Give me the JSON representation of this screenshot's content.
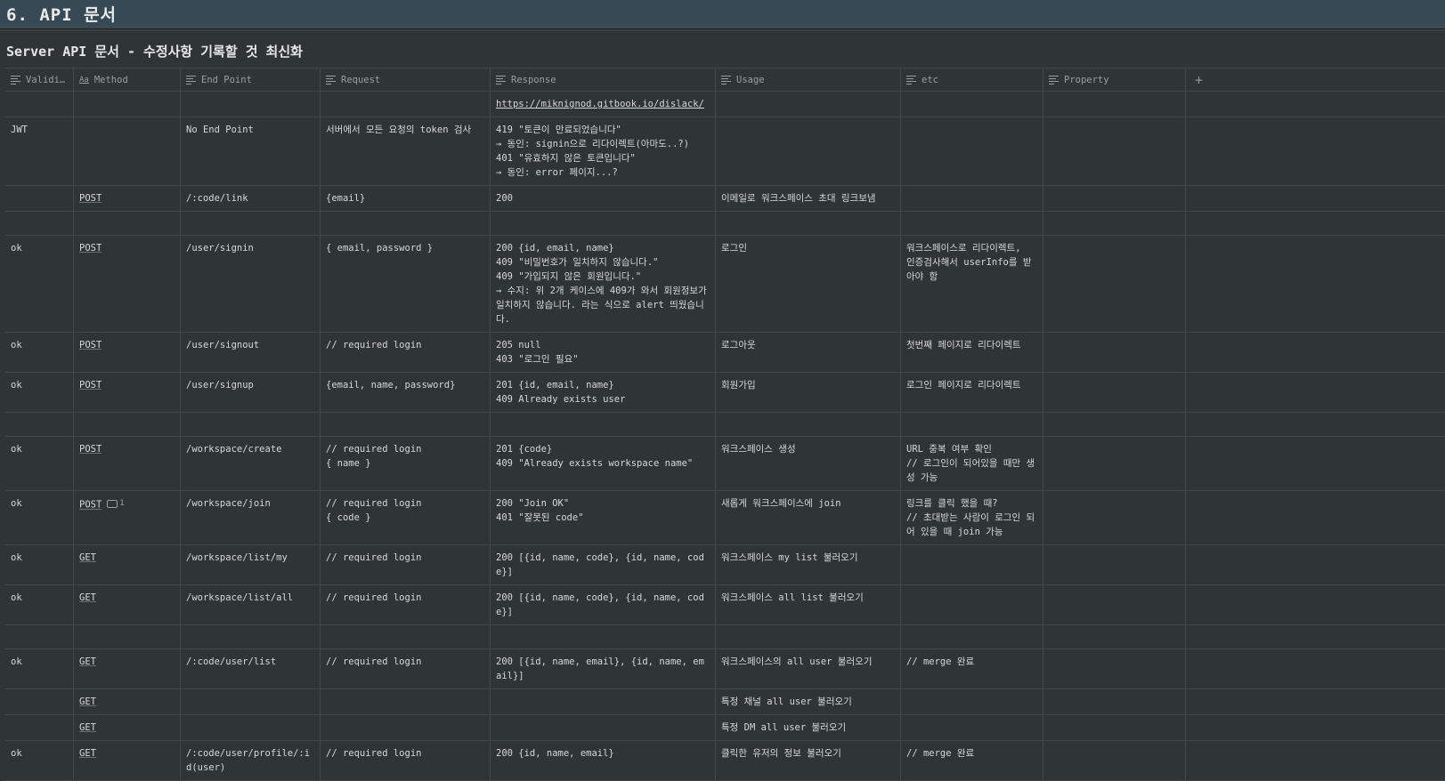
{
  "page": {
    "heading": "6. API 문서",
    "subtitle": "Server API 문서  - 수정사항 기록할 것 최신화"
  },
  "table": {
    "columns": [
      {
        "label": "Validi…",
        "icon": "text-lines-icon"
      },
      {
        "label": "Method",
        "icon": "title-aa-icon"
      },
      {
        "label": "End Point",
        "icon": "text-lines-icon"
      },
      {
        "label": "Request",
        "icon": "text-lines-icon"
      },
      {
        "label": "Response",
        "icon": "text-lines-icon"
      },
      {
        "label": "Usage",
        "icon": "text-lines-icon"
      },
      {
        "label": "etc",
        "icon": "text-lines-icon"
      },
      {
        "label": "Property",
        "icon": "text-lines-icon"
      }
    ],
    "add_column": "+",
    "rows": [
      {
        "validity": "",
        "method": "",
        "endpoint": "",
        "request": "",
        "response": "https://miknignod.gitbook.io/dislack/",
        "usage": "",
        "etc": "",
        "property": ""
      },
      {
        "validity": "JWT",
        "method": "",
        "endpoint": "No End Point",
        "request": "서버에서 모든 요청의 token 검사",
        "response": "419 \"토큰이 만료되었습니다\"\n→ 동인: signin으로 리다이렉트(아마도..?)\n401 \"유효하지 않은 토큰입니다\"\n→ 동인: error 페이지...?",
        "usage": "",
        "etc": "",
        "property": ""
      },
      {
        "validity": "",
        "method": "POST",
        "endpoint": "/:code/link",
        "request": "{email}",
        "response": "200",
        "usage": "이메일로 워크스페이스 초대 링크보냄",
        "etc": "",
        "property": ""
      },
      {
        "validity": "",
        "method": "",
        "endpoint": "",
        "request": "",
        "response": "",
        "usage": "",
        "etc": "",
        "property": ""
      },
      {
        "validity": "ok",
        "method": "POST",
        "endpoint": "/user/signin",
        "request": "{ email, password }",
        "response": "200 {id, email, name}\n409 \"비밀번호가 일치하지 않습니다.\"\n409 \"가입되지 않은 회원입니다.\"\n→ 수지: 위 2개 케이스에 409가 와서 회원정보가 일치하지 않습니다. 라는 식으로 alert 띄웠습니다.",
        "usage": "로그인",
        "etc": "워크스페이스로 리다이렉트,\n인증검사해서 userInfo를 받아야 함",
        "property": ""
      },
      {
        "validity": "ok",
        "method": "POST",
        "endpoint": "/user/signout",
        "request": "// required login",
        "response": "205 null\n403 \"로그인 필요\"",
        "usage": "로그아웃",
        "etc": "첫번째 페이지로 리다이렉트",
        "property": ""
      },
      {
        "validity": "ok",
        "method": "POST",
        "endpoint": "/user/signup",
        "request": "{email, name, password}",
        "response": "201 {id, email, name}\n409 Already exists user",
        "usage": "회원가입",
        "etc": "로그인 페이지로 리다이렉트",
        "property": ""
      },
      {
        "validity": "",
        "method": "",
        "endpoint": "",
        "request": "",
        "response": "",
        "usage": "",
        "etc": "",
        "property": ""
      },
      {
        "validity": "ok",
        "method": "POST",
        "endpoint": "/workspace/create",
        "request": "// required login\n{ name }",
        "response": "201 {code}\n409 \"Already exists workspace name\"",
        "usage": "워크스페이스 생성",
        "etc": "URL 중복 여부 확인\n// 로그인이 되어있을 때만 생성 가능",
        "property": ""
      },
      {
        "validity": "ok",
        "method": "POST",
        "comment_count": "1",
        "endpoint": "/workspace/join",
        "request": "// required login\n{ code }",
        "response": "200 \"Join OK\"\n401 \"잘못된 code\"",
        "usage": "새롭게 워크스페이스에 join",
        "etc": "링크를 클릭 했을 때?\n// 초대받는 사람이 로그인 되어 있을 때 join 가능",
        "property": ""
      },
      {
        "validity": "ok",
        "method": "GET",
        "endpoint": "/workspace/list/my",
        "request": "// required login",
        "response": "200 [{id, name, code}, {id, name, code}]",
        "usage": "워크스페이스 my list 불러오기",
        "etc": "",
        "property": ""
      },
      {
        "validity": "ok",
        "method": "GET",
        "endpoint": "/workspace/list/all",
        "request": "// required login",
        "response": "200 [{id, name, code}, {id, name, code}]",
        "usage": "워크스페이스 all list 불러오기",
        "etc": "",
        "property": ""
      },
      {
        "validity": "",
        "method": "",
        "endpoint": "",
        "request": "",
        "response": "",
        "usage": "",
        "etc": "",
        "property": ""
      },
      {
        "validity": "ok",
        "method": "GET",
        "endpoint": "/:code/user/list",
        "request": "// required login",
        "response": "200 [{id, name, email}, {id, name, email}]",
        "usage": "워크스페이스의 all user 불러오기",
        "etc": "// merge 완료",
        "property": ""
      },
      {
        "validity": "",
        "method": "GET",
        "endpoint": "",
        "request": "",
        "response": "",
        "usage": "특정 채널 all user 불러오기",
        "etc": "",
        "property": ""
      },
      {
        "validity": "",
        "method": "GET",
        "endpoint": "",
        "request": "",
        "response": "",
        "usage": "특정 DM all user 불러오기",
        "etc": "",
        "property": ""
      },
      {
        "validity": "ok",
        "method": "GET",
        "endpoint": "/:code/user/profile/:id(user)",
        "request": "// required login",
        "response": "200 {id, name, email}",
        "usage": "클릭한 유저의 정보 불러오기",
        "etc": "// merge 완료",
        "property": ""
      }
    ]
  }
}
